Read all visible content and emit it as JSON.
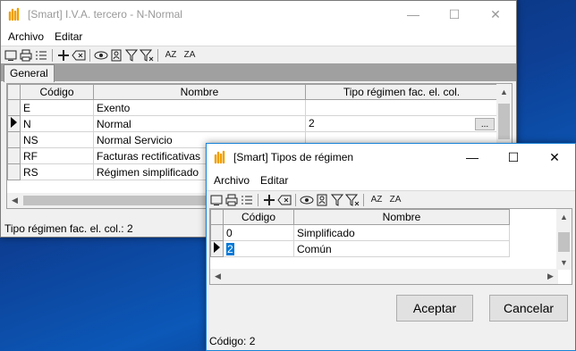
{
  "win1": {
    "title": "[Smart] I.V.A. tercero - N-Normal",
    "menu": [
      "Archivo",
      "Editar"
    ],
    "tab": "General",
    "columns": [
      "Código",
      "Nombre",
      "Tipo régimen fac. el. col."
    ],
    "rows": [
      {
        "codigo": "E",
        "nombre": "Exento",
        "tipo": ""
      },
      {
        "codigo": "N",
        "nombre": "Normal",
        "tipo": "2",
        "ellipsis": "..."
      },
      {
        "codigo": "NS",
        "nombre": "Normal Servicio",
        "tipo": ""
      },
      {
        "codigo": "RF",
        "nombre": "Facturas rectificativas",
        "tipo": ""
      },
      {
        "codigo": "RS",
        "nombre": "Régimen simplificado",
        "tipo": ""
      }
    ],
    "status": "Tipo régimen fac. el. col.: 2"
  },
  "win2": {
    "title": "[Smart] Tipos de régimen",
    "menu": [
      "Archivo",
      "Editar"
    ],
    "columns": [
      "Código",
      "Nombre"
    ],
    "rows": [
      {
        "codigo": "0",
        "nombre": "Simplificado"
      },
      {
        "codigo": "2",
        "nombre": "Común"
      }
    ],
    "accept": "Aceptar",
    "cancel": "Cancelar",
    "status": "Código: 2"
  },
  "window_controls": {
    "minimize": "—",
    "maximize": "☐",
    "close": "✕"
  },
  "icons": [
    "window-icon",
    "print-icon",
    "list-icon",
    "add-icon",
    "delete-icon",
    "view-icon",
    "record-icon",
    "filter-icon",
    "clear-filter-icon",
    "sort-asc-icon",
    "sort-desc-icon"
  ],
  "toolbar_text": {
    "sort_asc": "AZ",
    "sort_desc": "ZA"
  },
  "colors": {
    "accent": "#0078d7",
    "app_icon": "#f0a000"
  }
}
